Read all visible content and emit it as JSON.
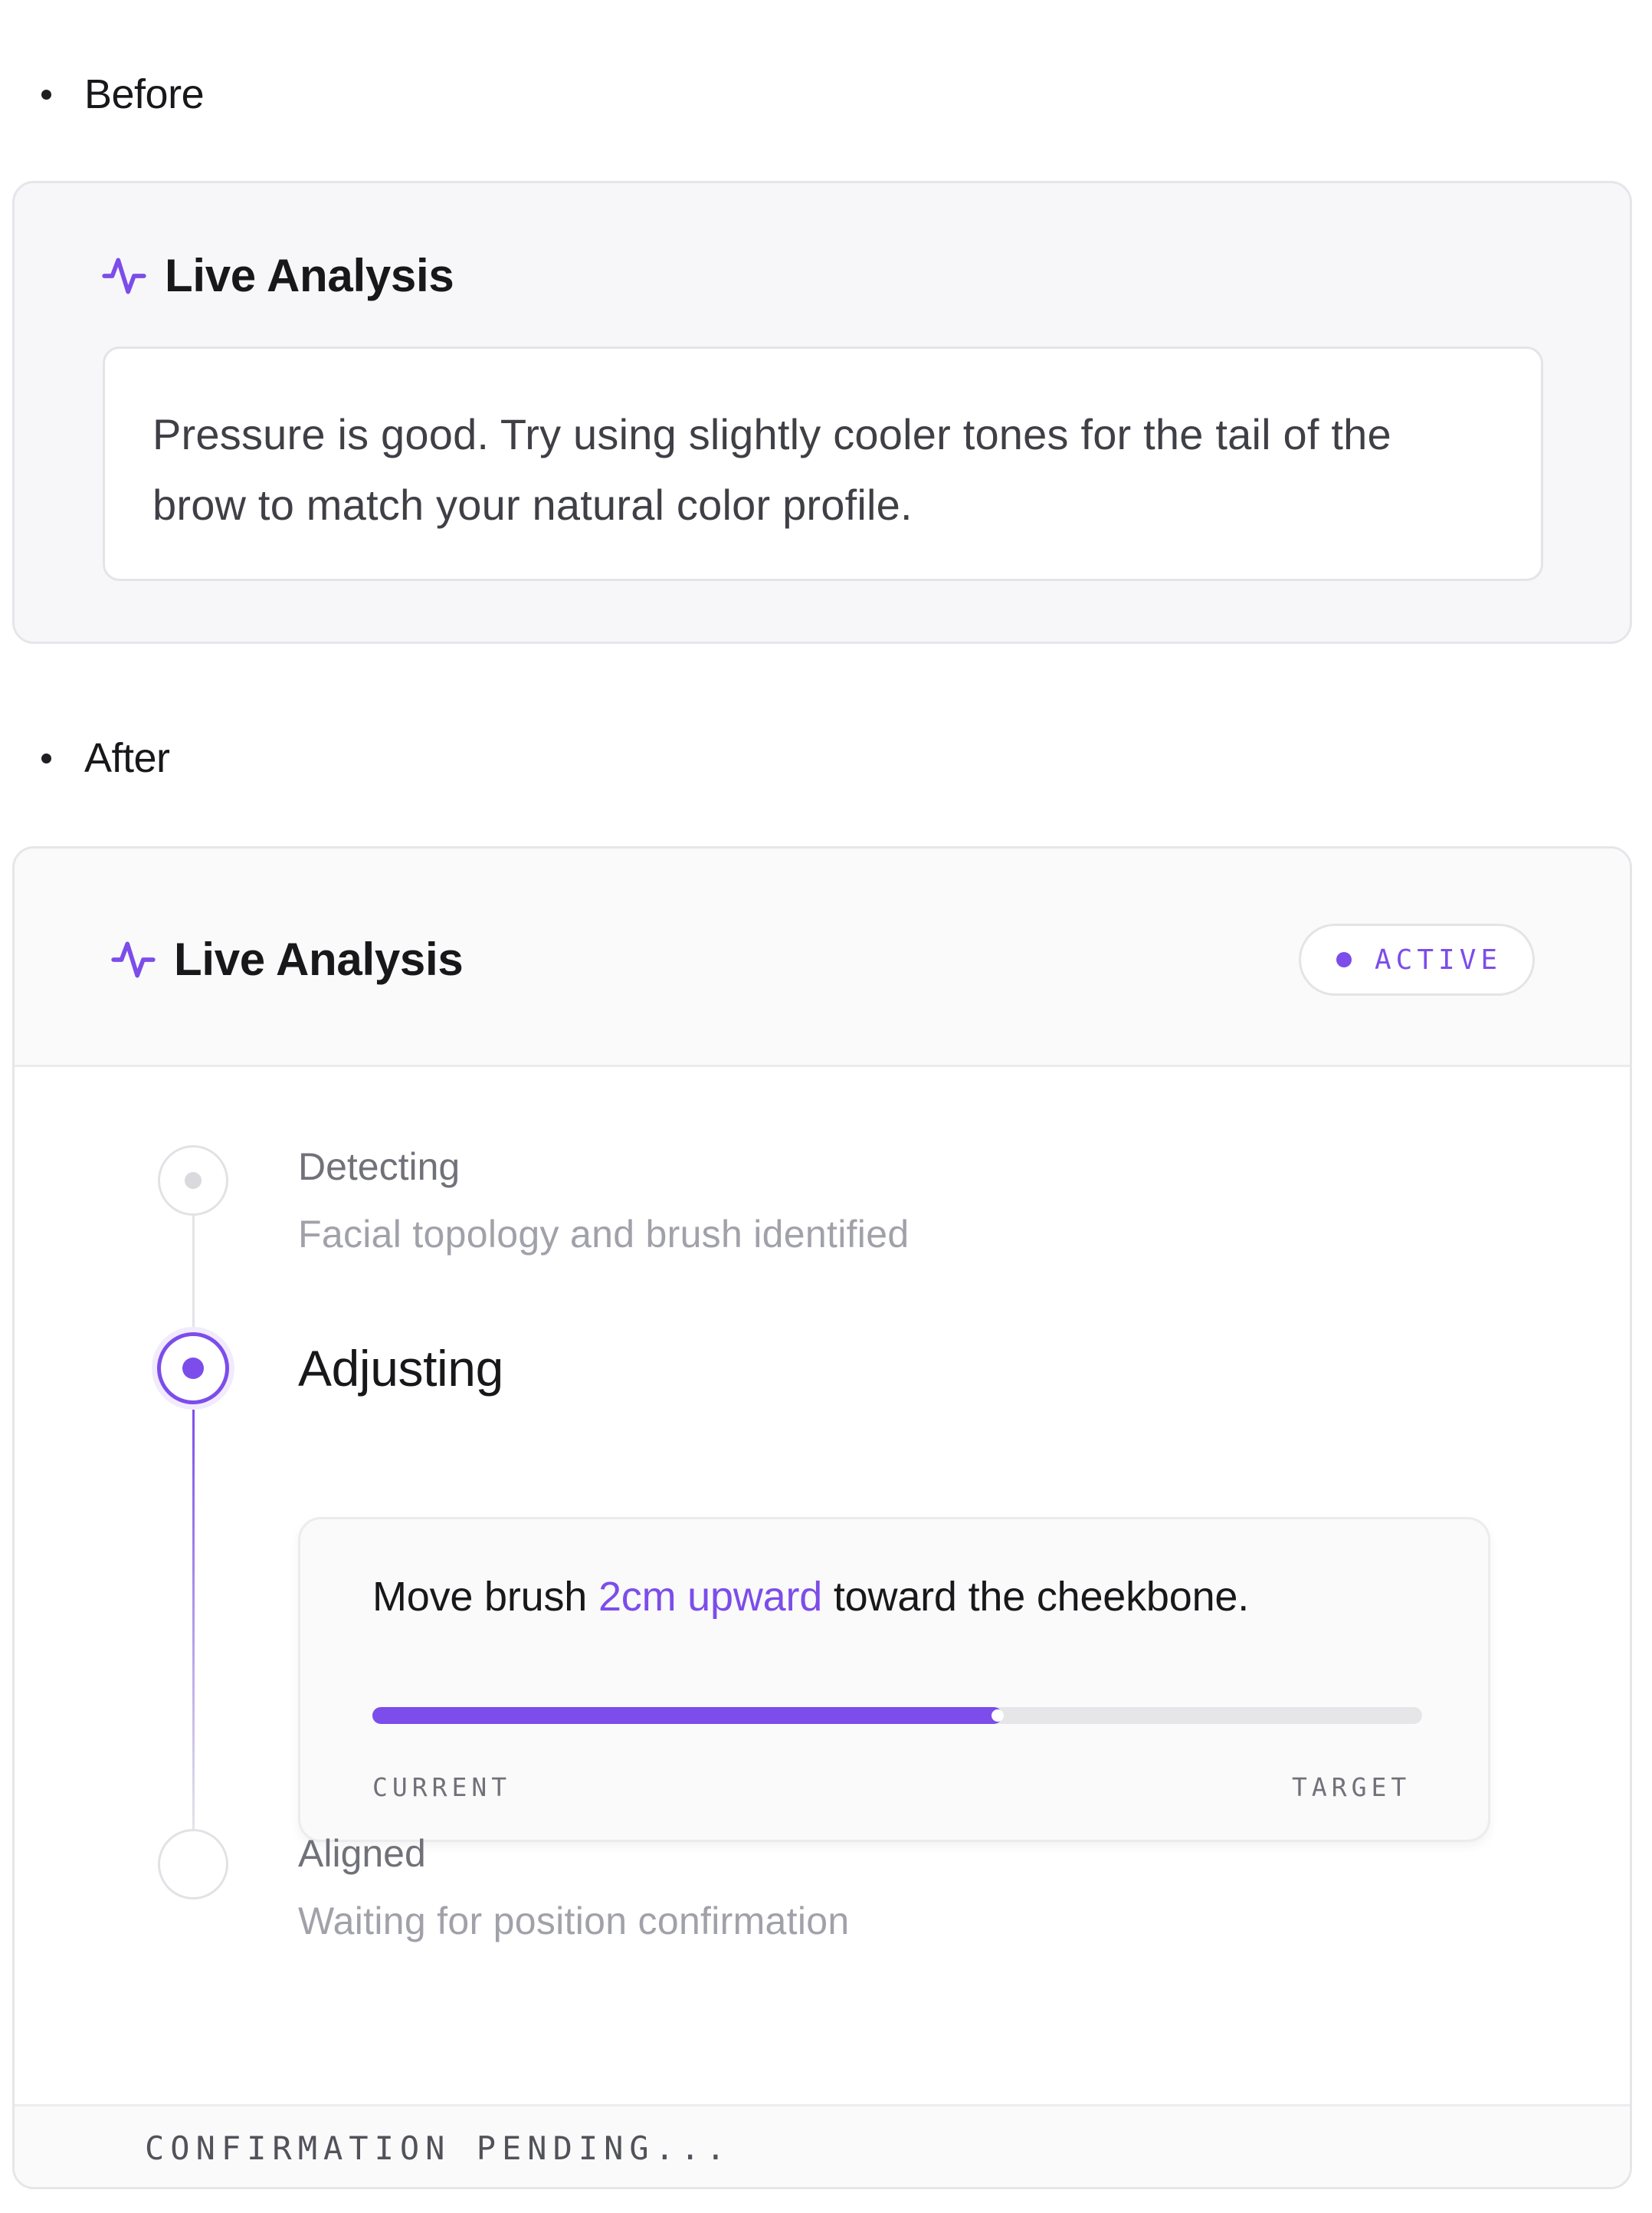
{
  "before": {
    "bullet_label": "Before",
    "card": {
      "title": "Live Analysis",
      "icon": "pulse-icon",
      "message": "Pressure is good. Try using slightly cooler tones for the tail of the brow to match your natural color profile."
    }
  },
  "after": {
    "bullet_label": "After",
    "card": {
      "title": "Live Analysis",
      "icon": "pulse-icon",
      "status": "ACTIVE",
      "steps": [
        {
          "title": "Detecting",
          "description": "Facial topology and brush identified",
          "state": "done"
        },
        {
          "title": "Adjusting",
          "state": "active",
          "instruction": {
            "prefix": "Move brush ",
            "highlight": "2cm upward",
            "suffix": " toward the cheekbone."
          },
          "progress": 0.6,
          "progress_start_label": "CURRENT",
          "progress_end_label": "TARGET"
        },
        {
          "title": "Aligned",
          "description": "Waiting for position confirmation",
          "state": "pending"
        }
      ],
      "footer": "CONFIRMATION PENDING..."
    }
  },
  "colors": {
    "accent": "#7c4dea",
    "card_bg": "#f7f7fa",
    "border": "#e6e6ea"
  }
}
